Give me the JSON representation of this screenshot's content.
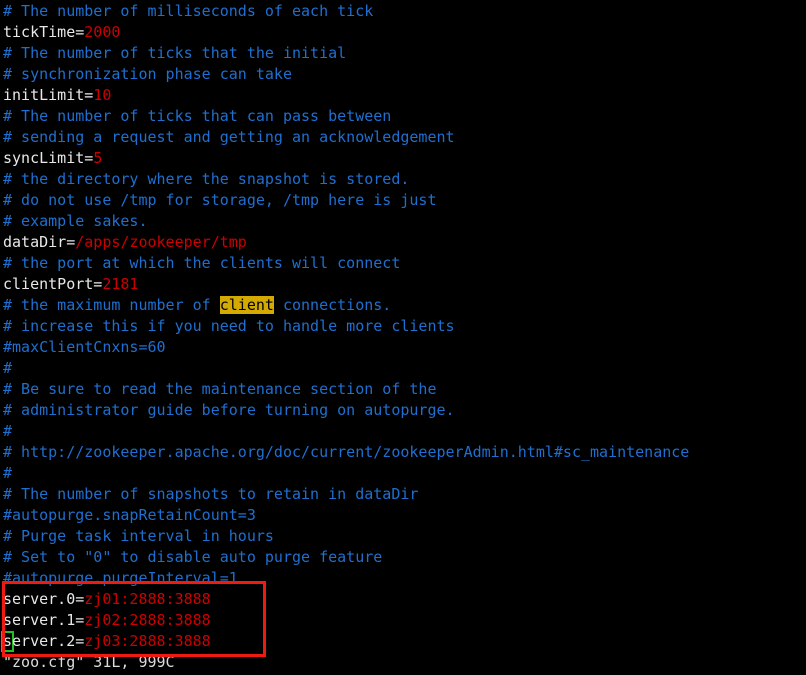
{
  "terminal": {
    "background": "#000000",
    "comment_color": "#1f6fd0",
    "value_color": "#cc0000",
    "key_color": "#e8e8e8",
    "search_highlight_bg": "#d4aa00",
    "search_highlight_fg": "#000000",
    "cursor_color": "#22c020",
    "annotation_color": "#ef1a12"
  },
  "file": {
    "name": "zoo.cfg",
    "status_line": "\"zoo.cfg\" 31L, 999C",
    "lines": 31,
    "chars": 999
  },
  "lines": [
    {
      "n": 1,
      "type": "comment",
      "text": "# The number of milliseconds of each tick"
    },
    {
      "n": 2,
      "type": "setting",
      "key": "tickTime=",
      "value": "2000"
    },
    {
      "n": 3,
      "type": "comment",
      "text": "# The number of ticks that the initial"
    },
    {
      "n": 4,
      "type": "comment",
      "text": "# synchronization phase can take"
    },
    {
      "n": 5,
      "type": "setting",
      "key": "initLimit=",
      "value": "10"
    },
    {
      "n": 6,
      "type": "comment",
      "text": "# The number of ticks that can pass between"
    },
    {
      "n": 7,
      "type": "comment",
      "text": "# sending a request and getting an acknowledgement"
    },
    {
      "n": 8,
      "type": "setting",
      "key": "syncLimit=",
      "value": "5"
    },
    {
      "n": 9,
      "type": "comment",
      "text": "# the directory where the snapshot is stored."
    },
    {
      "n": 10,
      "type": "comment",
      "text": "# do not use /tmp for storage, /tmp here is just"
    },
    {
      "n": 11,
      "type": "comment",
      "text": "# example sakes."
    },
    {
      "n": 12,
      "type": "setting",
      "key": "dataDir=",
      "value": "/apps/zookeeper/tmp"
    },
    {
      "n": 13,
      "type": "comment",
      "text": "# the port at which the clients will connect"
    },
    {
      "n": 14,
      "type": "setting",
      "key": "clientPort=",
      "value": "2181"
    },
    {
      "n": 15,
      "type": "comment-highlight",
      "pre": "# the maximum number of ",
      "match": "client",
      "post": " connections."
    },
    {
      "n": 16,
      "type": "comment",
      "text": "# increase this if you need to handle more clients"
    },
    {
      "n": 17,
      "type": "comment",
      "text": "#maxClientCnxns=60"
    },
    {
      "n": 18,
      "type": "comment",
      "text": "#"
    },
    {
      "n": 19,
      "type": "comment",
      "text": "# Be sure to read the maintenance section of the"
    },
    {
      "n": 20,
      "type": "comment",
      "text": "# administrator guide before turning on autopurge."
    },
    {
      "n": 21,
      "type": "comment",
      "text": "#"
    },
    {
      "n": 22,
      "type": "comment",
      "text": "# http://zookeeper.apache.org/doc/current/zookeeperAdmin.html#sc_maintenance"
    },
    {
      "n": 23,
      "type": "comment",
      "text": "#"
    },
    {
      "n": 24,
      "type": "comment",
      "text": "# The number of snapshots to retain in dataDir"
    },
    {
      "n": 25,
      "type": "comment",
      "text": "#autopurge.snapRetainCount=3"
    },
    {
      "n": 26,
      "type": "comment",
      "text": "# Purge task interval in hours"
    },
    {
      "n": 27,
      "type": "comment",
      "text": "# Set to \"0\" to disable auto purge feature"
    },
    {
      "n": 28,
      "type": "comment",
      "text": "#autopurge.purgeInterval=1"
    },
    {
      "n": 29,
      "type": "setting",
      "key": "server.0=",
      "value": "zj01:2888:3888"
    },
    {
      "n": 30,
      "type": "setting",
      "key": "server.1=",
      "value": "zj02:2888:3888"
    },
    {
      "n": 31,
      "type": "setting-cursor",
      "cursor_char": "s",
      "key": "erver.2=",
      "value": "zj03:2888:3888"
    }
  ],
  "search": {
    "highlighted_term": "client"
  },
  "annotation": {
    "shape": "rectangle",
    "color": "#ef1a12",
    "covers": "server.0 / server.1 / server.2 lines"
  }
}
